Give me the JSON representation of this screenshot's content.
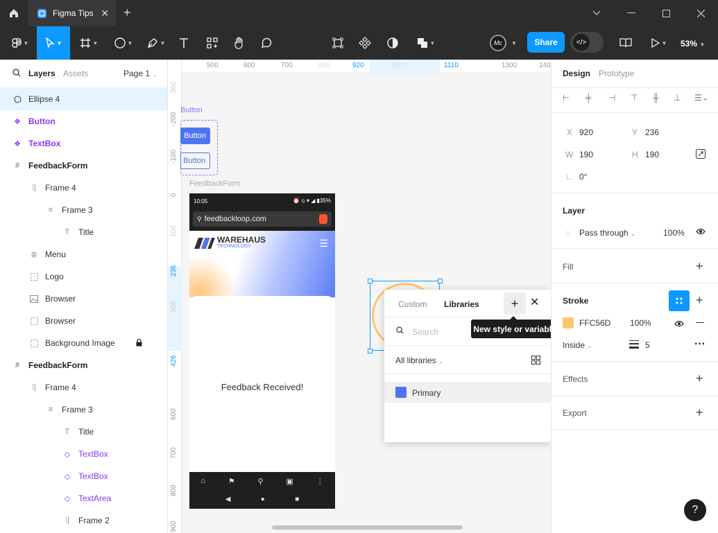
{
  "titlebar": {
    "tab_title": "Figma Tips"
  },
  "toolbar": {
    "share_label": "Share",
    "zoom": "53%",
    "avatar_initials": "Mc"
  },
  "left_panel": {
    "tab_layers": "Layers",
    "tab_assets": "Assets",
    "page": "Page 1",
    "layers": [
      {
        "name": "Ellipse 4",
        "icon": "ellipse-icon"
      },
      {
        "name": "Button",
        "icon": "component-icon"
      },
      {
        "name": "TextBox",
        "icon": "component-icon"
      },
      {
        "name": "FeedbackForm",
        "icon": "frame-icon"
      },
      {
        "name": "Frame 4",
        "icon": "autolayout-horizontal-icon"
      },
      {
        "name": "Frame 3",
        "icon": "autolayout-vertical-icon"
      },
      {
        "name": "Title",
        "icon": "text-icon"
      },
      {
        "name": "Menu",
        "icon": "autolayout-vertical-icon"
      },
      {
        "name": "Logo",
        "icon": "dashed-frame-icon"
      },
      {
        "name": "Browser",
        "icon": "image-icon"
      },
      {
        "name": "Browser",
        "icon": "dashed-frame-icon"
      },
      {
        "name": "Background Image",
        "icon": "dashed-frame-icon"
      },
      {
        "name": "FeedbackForm",
        "icon": "frame-icon"
      },
      {
        "name": "Frame 4",
        "icon": "autolayout-horizontal-icon"
      },
      {
        "name": "Frame 3",
        "icon": "autolayout-vertical-icon"
      },
      {
        "name": "Title",
        "icon": "text-icon"
      },
      {
        "name": "TextBox",
        "icon": "instance-icon"
      },
      {
        "name": "TextBox",
        "icon": "instance-icon"
      },
      {
        "name": "TextArea",
        "icon": "instance-icon"
      },
      {
        "name": "Frame 2",
        "icon": "autolayout-horizontal-icon"
      }
    ]
  },
  "canvas": {
    "ruler_top": [
      "500",
      "600",
      "700",
      "800",
      "920",
      "1000",
      "1110",
      "1300",
      "140"
    ],
    "ruler_left": [
      "-300",
      "-200",
      "-100",
      "0",
      "100",
      "236",
      "300",
      "426",
      "600",
      "700",
      "800",
      "900"
    ],
    "button_component_label": "Button",
    "button_label_1": "Button",
    "button_label_2": "Button",
    "frame_label": "FeedbackForm",
    "phone": {
      "time": "10:05",
      "battery": "35%",
      "url": "feedbackloop.com",
      "logo_name": "WAREHAUS",
      "logo_sub": "TECHNOLOGY",
      "message": "Feedback Received!"
    }
  },
  "style_popup": {
    "tab_custom": "Custom",
    "tab_libraries": "Libraries",
    "search_placeholder": "Search",
    "filter": "All libraries",
    "items": [
      {
        "name": "Primary",
        "color": "#4C75F2"
      }
    ],
    "tooltip": "New style or variable"
  },
  "right_panel": {
    "tab_design": "Design",
    "tab_prototype": "Prototype",
    "x_label": "X",
    "x": "920",
    "y_label": "Y",
    "y": "236",
    "w_label": "W",
    "w": "190",
    "h_label": "H",
    "h": "190",
    "rotation": "0°",
    "layer_title": "Layer",
    "blend": "Pass through",
    "layer_opacity": "100%",
    "fill_title": "Fill",
    "stroke_title": "Stroke",
    "stroke_color": "FFC56D",
    "stroke_color_hex": "#FFC56D",
    "stroke_opacity": "100%",
    "stroke_position": "Inside",
    "stroke_weight": "5",
    "effects_title": "Effects",
    "export_title": "Export"
  },
  "colors": {
    "accent": "#0D99FF",
    "component": "#8A38F5",
    "brand_blue": "#4C75F2"
  }
}
